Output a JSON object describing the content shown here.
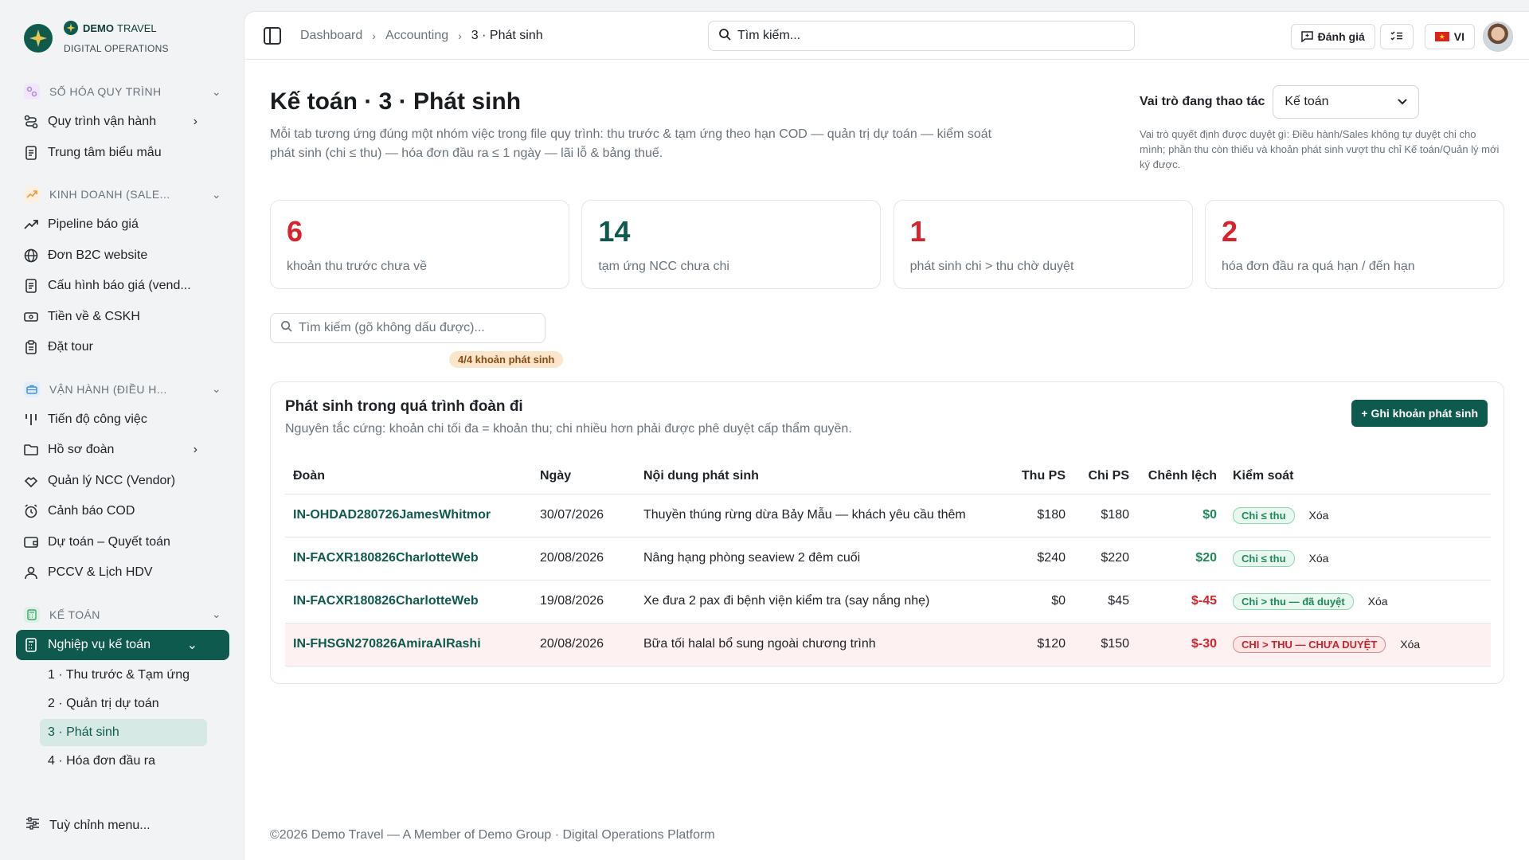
{
  "brand": {
    "name": "DEMO",
    "name_suffix": "TRAVEL",
    "subtitle": "DIGITAL OPERATIONS"
  },
  "sidebar": {
    "sections": [
      {
        "label": "SỐ HÓA QUY TRÌNH",
        "icon": "workflow-icon",
        "color": "#b084e8",
        "items": [
          {
            "label": "Quy trình vận hành",
            "icon": "route-icon",
            "has_arrow": true
          },
          {
            "label": "Trung tâm biểu mẫu",
            "icon": "document-icon",
            "has_arrow": false
          }
        ]
      },
      {
        "label": "KINH DOANH (SALE...",
        "icon": "trending-up-icon",
        "color": "#e89a3c",
        "items": [
          {
            "label": "Pipeline báo giá",
            "icon": "trending-up-icon"
          },
          {
            "label": "Đơn B2C website",
            "icon": "globe-icon"
          },
          {
            "label": "Cấu hình báo giá (vend...",
            "icon": "document-icon"
          },
          {
            "label": "Tiền về & CSKH",
            "icon": "cash-icon"
          },
          {
            "label": "Đặt tour",
            "icon": "clipboard-icon"
          }
        ]
      },
      {
        "label": "VẬN HÀNH (ĐIỀU H...",
        "icon": "briefcase-icon",
        "color": "#4a90d9",
        "items": [
          {
            "label": "Tiến độ công việc",
            "icon": "progress-icon"
          },
          {
            "label": "Hồ sơ đoàn",
            "icon": "folder-icon",
            "has_arrow": true
          },
          {
            "label": "Quản lý NCC (Vendor)",
            "icon": "vendor-icon"
          },
          {
            "label": "Cảnh báo COD",
            "icon": "alarm-icon"
          },
          {
            "label": "Dự toán – Quyết toán",
            "icon": "wallet-icon"
          },
          {
            "label": "PCCV & Lịch HDV",
            "icon": "user-icon"
          }
        ]
      },
      {
        "label": "KẾ TOÁN",
        "icon": "calculator-icon",
        "color": "#3aa56b"
      }
    ],
    "active_item": {
      "label": "Nghiệp vụ kế toán",
      "icon": "calculator-icon"
    },
    "sub_items": [
      "1 · Thu trước & Tạm ứng",
      "2 · Quản trị dự toán",
      "3 · Phát sinh",
      "4 · Hóa đơn đầu ra"
    ],
    "customize": "Tuỳ chỉnh menu..."
  },
  "topbar": {
    "breadcrumb": [
      "Dashboard",
      "Accounting",
      "3 · Phát sinh"
    ],
    "search_placeholder": "Tìm kiếm...",
    "feedback": "Đánh giá",
    "language": "VI"
  },
  "page": {
    "title": "Kế toán · 3 · Phát sinh",
    "description": "Mỗi tab tương ứng đúng một nhóm việc trong file quy trình: thu trước & tạm ứng theo hạn COD — quản trị dự toán — kiểm soát phát sinh (chi ≤ thu) — hóa đơn đầu ra ≤ 1 ngày — lãi lỗ & bảng thuế.",
    "role_label": "Vai trò đang thao tác",
    "role_value": "Kế toán",
    "role_note": "Vai trò quyết định được duyệt gì: Điều hành/Sales không tự duyệt chi cho mình; phần thu còn thiếu và khoản phát sinh vượt thu chỉ Kế toán/Quản lý mới ký được."
  },
  "stats": [
    {
      "value": "6",
      "label": "khoản thu trước chưa về",
      "color": "#d8232a"
    },
    {
      "value": "14",
      "label": "tạm ứng NCC chưa chi",
      "color": "#0f5a4f"
    },
    {
      "value": "1",
      "label": "phát sinh chi > thu chờ duyệt",
      "color": "#d8232a"
    },
    {
      "value": "2",
      "label": "hóa đơn đầu ra quá hạn / đến hạn",
      "color": "#d8232a"
    }
  ],
  "filter": {
    "placeholder": "Tìm kiếm (gõ không dấu được)...",
    "count_badge": "4/4 khoản phát sinh"
  },
  "card": {
    "title": "Phát sinh trong quá trình đoàn đi",
    "subtitle": "Nguyên tắc cứng: khoản chi tối đa = khoản thu; chi nhiều hơn phải được phê duyệt cấp thẩm quyền.",
    "add_button": "+ Ghi khoản phát sinh",
    "columns": [
      "Đoàn",
      "Ngày",
      "Nội dung phát sinh",
      "Thu PS",
      "Chi PS",
      "Chênh lệch",
      "Kiểm soát"
    ],
    "rows": [
      {
        "code": "IN-OHDAD280726JamesWhitmor",
        "date": "30/07/2026",
        "desc": "Thuyền thúng rừng dừa Bảy Mẫu — khách yêu cầu thêm",
        "thu": "$180",
        "chi": "$180",
        "diff": "$0",
        "diff_color": "#1f8a58",
        "status": "Chi ≤ thu",
        "status_kind": "ok",
        "delete": "Xóa",
        "warn": false
      },
      {
        "code": "IN-FACXR180826CharlotteWeb",
        "date": "20/08/2026",
        "desc": "Nâng hạng phòng seaview 2 đêm cuối",
        "thu": "$240",
        "chi": "$220",
        "diff": "$20",
        "diff_color": "#1f8a58",
        "status": "Chi ≤ thu",
        "status_kind": "ok",
        "delete": "Xóa",
        "warn": false
      },
      {
        "code": "IN-FACXR180826CharlotteWeb",
        "date": "19/08/2026",
        "desc": "Xe đưa 2 pax đi bệnh viện kiểm tra (say nắng nhẹ)",
        "thu": "$0",
        "chi": "$45",
        "diff": "$-45",
        "diff_color": "#d8232a",
        "status": "Chi > thu — đã duyệt",
        "status_kind": "ok",
        "delete": "Xóa",
        "warn": false
      },
      {
        "code": "IN-FHSGN270826AmiraAlRashi",
        "date": "20/08/2026",
        "desc": "Bữa tối halal bổ sung ngoài chương trình",
        "thu": "$120",
        "chi": "$150",
        "diff": "$-30",
        "diff_color": "#d8232a",
        "status": "CHI > THU — CHƯA DUYỆT",
        "status_kind": "bad",
        "delete": "Xóa",
        "warn": true
      }
    ]
  },
  "footer": "©2026 Demo Travel — A Member of Demo Group · Digital Operations Platform"
}
